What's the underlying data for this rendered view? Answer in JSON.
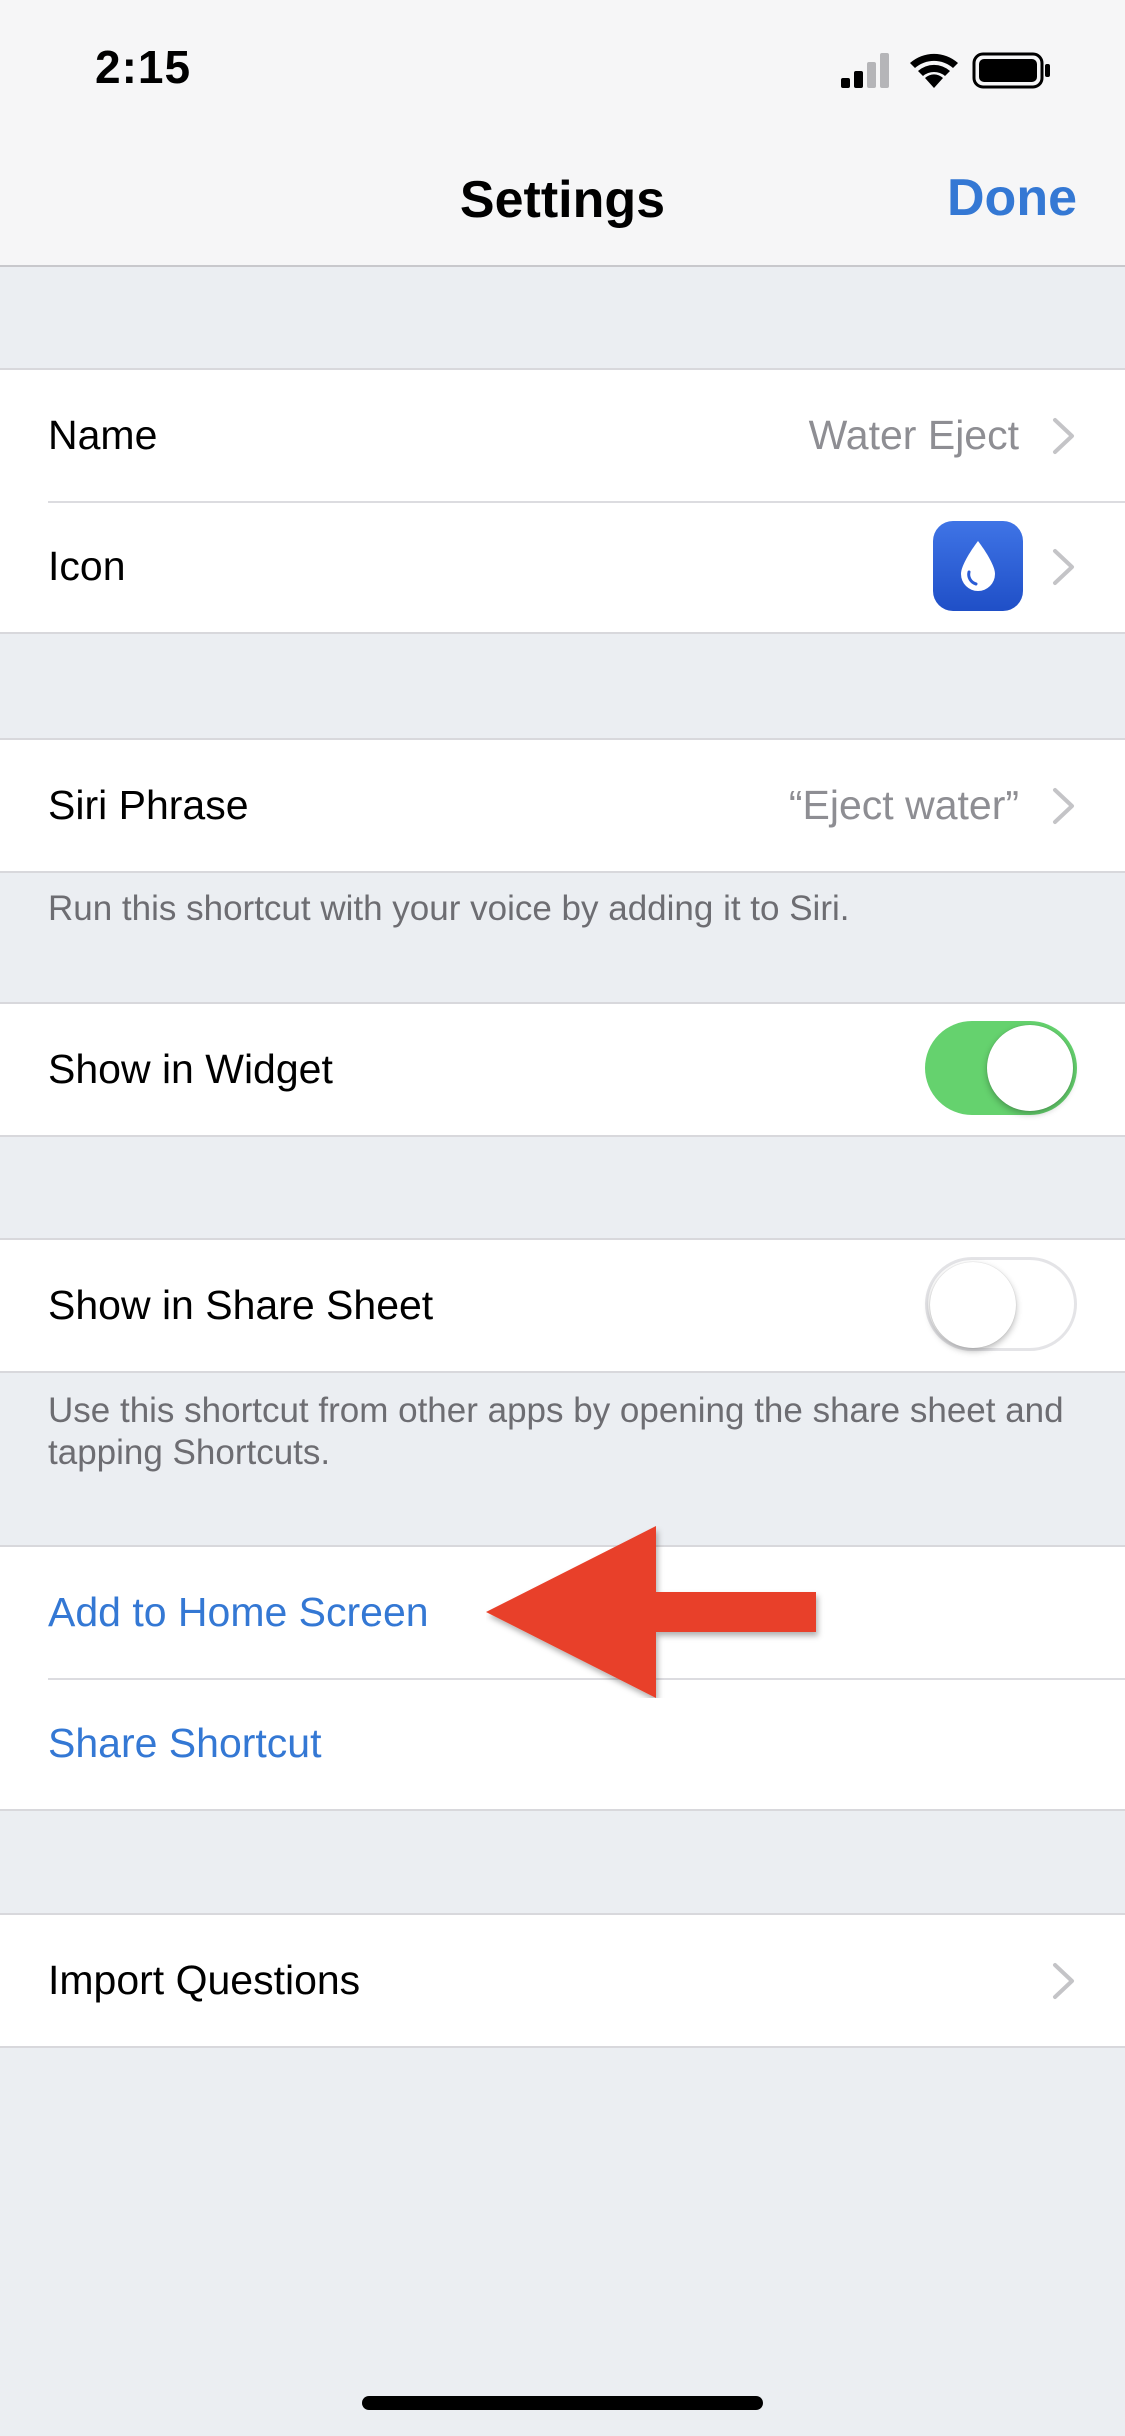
{
  "status_bar": {
    "time": "2:15",
    "icons": [
      "cellular-signal-icon",
      "wifi-icon",
      "battery-icon"
    ]
  },
  "nav": {
    "title": "Settings",
    "done_label": "Done",
    "accent_color": "#3478d4"
  },
  "groups": {
    "identity": {
      "name_label": "Name",
      "name_value": "Water Eject",
      "icon_label": "Icon",
      "icon_name": "water-drop-icon"
    },
    "siri": {
      "label": "Siri Phrase",
      "value": "“Eject water”",
      "footnote": "Run this shortcut with your voice by adding it to Siri."
    },
    "widget": {
      "label": "Show in Widget",
      "enabled": true
    },
    "share_sheet": {
      "label": "Show in Share Sheet",
      "enabled": false,
      "footnote": "Use this shortcut from other apps by opening the share sheet and tapping Shortcuts."
    },
    "actions": {
      "add_home_label": "Add to Home Screen",
      "share_label": "Share Shortcut"
    },
    "import": {
      "label": "Import Questions"
    }
  },
  "annotation": {
    "icon_name": "red-arrow-icon",
    "color": "#e8402a"
  },
  "colors": {
    "toggle_on": "#65d26e",
    "background": "#ebeef2"
  }
}
